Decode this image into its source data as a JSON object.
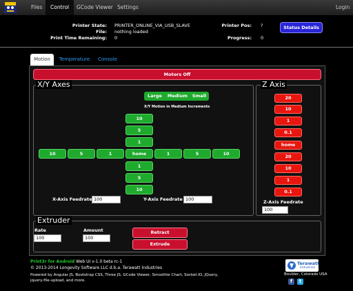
{
  "nav": {
    "items": [
      "Files",
      "Control",
      "GCode Viewer",
      "Settings"
    ],
    "login": "Login"
  },
  "status": {
    "printer_state_label": "Printer State:",
    "printer_state_value": "PRINTER_ONLINE_VIA_USB_SLAVE",
    "file_label": "File:",
    "file_value": "nothing loaded",
    "time_label": "Print Time Remaining:",
    "time_value": "0",
    "pos_label": "Printer Pos:",
    "pos_value": "?",
    "progress_label": "Progress:",
    "progress_value": "0",
    "details_button": "Status Details"
  },
  "tabs": [
    "Motion",
    "Temperature",
    "Console"
  ],
  "motion": {
    "motors_off": "Motors Off",
    "xy_legend": "X/Y Axes",
    "increment_options": [
      "Large",
      "Medium",
      "Small"
    ],
    "increment_caption": "X/Y Motion in Medium Increments",
    "y_up": [
      "10",
      "5",
      "1"
    ],
    "x_left": [
      "10",
      "5",
      "1"
    ],
    "home": "home",
    "x_right": [
      "1",
      "5",
      "10"
    ],
    "y_down": [
      "1",
      "5",
      "10"
    ],
    "x_feed_label": "X-Axis Feedrate",
    "x_feed_value": "100",
    "y_feed_label": "Y-Axis Feedrate",
    "y_feed_value": "100",
    "z_legend": "Z Axis",
    "z_buttons": [
      "20",
      "10",
      "1",
      "0.1",
      "home",
      "20",
      "10",
      "1",
      "0.1"
    ],
    "z_feed_label": "Z-Axis Feedrate",
    "z_feed_value": "100"
  },
  "extruder": {
    "legend": "Extruder",
    "rate_label": "Rate",
    "rate_value": "100",
    "amount_label": "Amount",
    "amount_value": "100",
    "retract": "Retract",
    "extrude": "Extrude"
  },
  "footer": {
    "app_name": "Print3r for Android",
    "version": "Web UI v-1.0 beta rc-1",
    "copyright": "© 2013-2014 Longevity Software LLC d.b.a. Terawatt Industries",
    "powered": "Powered by Angular JS, Bootstrap CSS, Three JS, GCode Viewer, Smoothie Chart, Socket.IO, JQuery,",
    "powered2": "jquery-file-upload, and more.",
    "brand": "Terawatt",
    "brand_sub": "Industries",
    "location": "Boulder, Colorado  USA"
  }
}
